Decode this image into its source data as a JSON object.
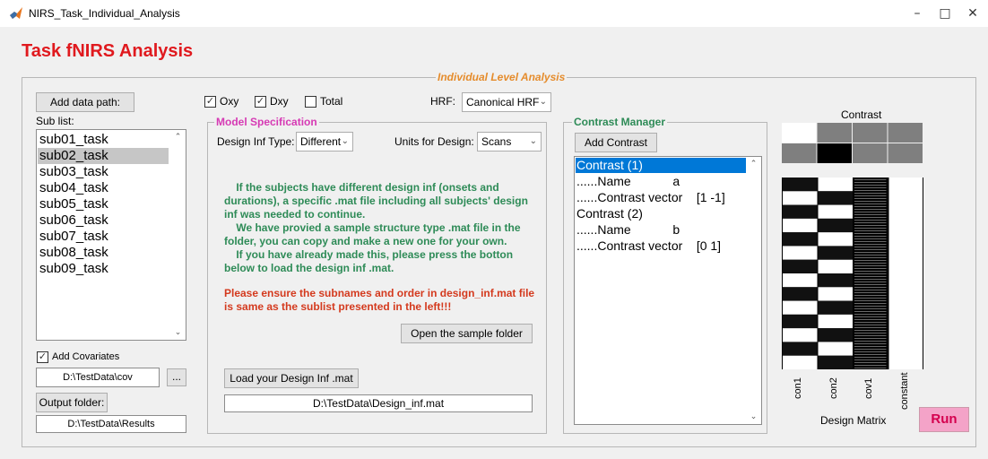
{
  "window": {
    "title": "NIRS_Task_Individual_Analysis"
  },
  "app": {
    "title": "Task fNIRS Analysis"
  },
  "panel": {
    "title": "Individual Level Analysis"
  },
  "left": {
    "add_data_path": "Add data path:",
    "sub_list_label": "Sub list:",
    "subjects": [
      "sub01_task",
      "sub02_task",
      "sub03_task",
      "sub04_task",
      "sub05_task",
      "sub06_task",
      "sub07_task",
      "sub08_task",
      "sub09_task"
    ],
    "selected_index": 1,
    "add_covariates_label": "Add Covariates",
    "covariates_path": "D:\\TestData\\cov",
    "browse_label": "...",
    "output_folder_label": "Output folder:",
    "output_folder_path": "D:\\TestData\\Results"
  },
  "signals": {
    "oxy": "Oxy",
    "dxy": "Dxy",
    "total": "Total"
  },
  "hrf": {
    "label": "HRF:",
    "value": "Canonical HRF"
  },
  "model": {
    "title": "Model Specification",
    "design_inf_label": "Design Inf Type:",
    "design_inf_value": "Different",
    "units_label": "Units for Design:",
    "units_value": "Scans",
    "info_lines": [
      "    If the subjects have different design inf (onsets and",
      "durations), a specific .mat file including all subjects' design",
      "inf was needed to continue.",
      "    We have provied a sample structure type .mat file in the",
      "folder, you can copy and make a new one for your own.",
      "    If you have already made this, please press the botton",
      "below to load the design inf .mat."
    ],
    "warning_lines": [
      "Please ensure the subnames and order in design_inf.mat file",
      "is same as the sublist presented in the left!!!"
    ],
    "open_sample_label": "Open the sample folder",
    "load_design_label": "Load your Design Inf .mat",
    "design_path": "D:\\TestData\\Design_inf.mat"
  },
  "contrast_manager": {
    "title": "Contrast Manager",
    "add_contrast_label": "Add Contrast",
    "lines": [
      {
        "text": "Contrast (1)",
        "selected": true
      },
      {
        "text": "......Name            a",
        "selected": false
      },
      {
        "text": "......Contrast vector    [1 -1]",
        "selected": false
      },
      {
        "text": "Contrast (2)",
        "selected": false
      },
      {
        "text": "......Name            b",
        "selected": false
      },
      {
        "text": "......Contrast vector    [0 1]",
        "selected": false
      }
    ]
  },
  "contrast_plot": {
    "title": "Contrast",
    "rows": [
      [
        1,
        0.5,
        0.5,
        0.5
      ],
      [
        0.5,
        0,
        0.5,
        0.5
      ]
    ],
    "color_white": "#ffffff",
    "color_gray": "#7f7f7f",
    "color_black": "#000000"
  },
  "design_matrix": {
    "title": "Design Matrix",
    "columns": [
      "con1",
      "con2",
      "cov1",
      "constant"
    ],
    "blocks": 14
  },
  "run": {
    "label": "Run",
    "color": "#f4a3c8"
  },
  "colors": {
    "accent_orange": "#e58c2c",
    "accent_magenta": "#d63ab4",
    "accent_green": "#2e8b57",
    "title_red": "#e0191e",
    "selection_blue": "#0078d7"
  }
}
